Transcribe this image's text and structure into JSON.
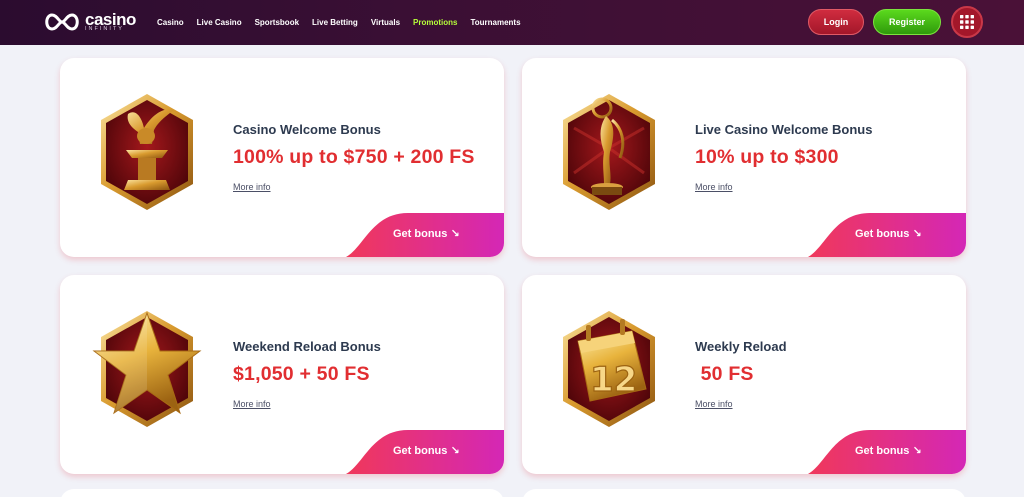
{
  "header": {
    "logo": {
      "name": "casino",
      "tagline": "INFINITY"
    },
    "nav": [
      {
        "label": "Casino",
        "active": false
      },
      {
        "label": "Live Casino",
        "active": false
      },
      {
        "label": "Sportsbook",
        "active": false
      },
      {
        "label": "Live Betting",
        "active": false
      },
      {
        "label": "Virtuals",
        "active": false
      },
      {
        "label": "Promotions",
        "active": true
      },
      {
        "label": "Tournaments",
        "active": false
      }
    ],
    "login_label": "Login",
    "register_label": "Register",
    "menu_icon": "grid-icon"
  },
  "cards": [
    {
      "title": "Casino Welcome Bonus",
      "amount": "100% up to $750 + 200 FS",
      "more": "More info",
      "cta": "Get bonus ↘",
      "icon": "winged-lion-trophy-icon"
    },
    {
      "title": "Live Casino Welcome Bonus",
      "amount": "10% up to $300",
      "more": "More info",
      "cta": "Get bonus ↘",
      "icon": "statuette-award-icon"
    },
    {
      "title": "Weekend Reload Bonus",
      "amount": "$1,050 + 50 FS",
      "more": "More info",
      "cta": "Get bonus ↘",
      "icon": "gold-star-icon"
    },
    {
      "title": "Weekly Reload",
      "amount": " 50 FS",
      "more": "More info",
      "cta": "Get bonus ↘",
      "icon": "calendar-12-icon"
    }
  ],
  "colors": {
    "header_bg": "#3a0f34",
    "active_nav": "#b6ff3a",
    "amount": "#e12e31",
    "cta_gradient_start": "#f0385a",
    "cta_gradient_end": "#d427b6",
    "login": "#c02238",
    "register": "#43c111"
  }
}
